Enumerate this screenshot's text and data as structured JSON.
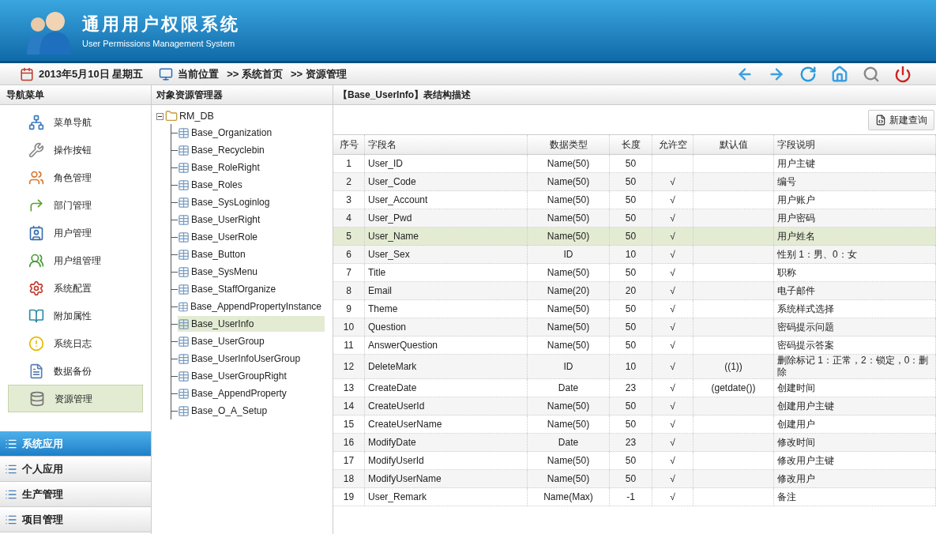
{
  "header": {
    "title": "通用用户权限系统",
    "subtitle": "User Permissions Management System"
  },
  "toolbar": {
    "date": "2013年5月10日 星期五",
    "location_label": "当前位置",
    "breadcrumb": [
      ">> 系统首页",
      ">> 资源管理"
    ],
    "actions": [
      {
        "kind": "back"
      },
      {
        "kind": "forward"
      },
      {
        "kind": "refresh"
      },
      {
        "kind": "home"
      },
      {
        "kind": "search"
      },
      {
        "kind": "power"
      }
    ]
  },
  "nav": {
    "title": "导航菜单",
    "items": [
      {
        "label": "菜单导航",
        "selected": false
      },
      {
        "label": "操作按钮",
        "selected": false
      },
      {
        "label": "角色管理",
        "selected": false
      },
      {
        "label": "部门管理",
        "selected": false
      },
      {
        "label": "用户管理",
        "selected": false
      },
      {
        "label": "用户组管理",
        "selected": false
      },
      {
        "label": "系统配置",
        "selected": false
      },
      {
        "label": "附加属性",
        "selected": false
      },
      {
        "label": "系统日志",
        "selected": false
      },
      {
        "label": "数据备份",
        "selected": false
      },
      {
        "label": "资源管理",
        "selected": true
      }
    ],
    "sections": [
      {
        "label": "系统应用",
        "selected": true
      },
      {
        "label": "个人应用",
        "selected": false
      },
      {
        "label": "生产管理",
        "selected": false
      },
      {
        "label": "项目管理",
        "selected": false
      }
    ]
  },
  "tree": {
    "title": "对象资源管理器",
    "root": {
      "label": "RM_DB",
      "expanded": true,
      "children": [
        {
          "label": "Base_Organization",
          "selected": false
        },
        {
          "label": "Base_Recyclebin",
          "selected": false
        },
        {
          "label": "Base_RoleRight",
          "selected": false
        },
        {
          "label": "Base_Roles",
          "selected": false
        },
        {
          "label": "Base_SysLoginlog",
          "selected": false
        },
        {
          "label": "Base_UserRight",
          "selected": false
        },
        {
          "label": "Base_UserRole",
          "selected": false
        },
        {
          "label": "Base_Button",
          "selected": false
        },
        {
          "label": "Base_SysMenu",
          "selected": false
        },
        {
          "label": "Base_StaffOrganize",
          "selected": false
        },
        {
          "label": "Base_AppendPropertyInstance",
          "selected": false
        },
        {
          "label": "Base_UserInfo",
          "selected": true
        },
        {
          "label": "Base_UserGroup",
          "selected": false
        },
        {
          "label": "Base_UserInfoUserGroup",
          "selected": false
        },
        {
          "label": "Base_UserGroupRight",
          "selected": false
        },
        {
          "label": "Base_AppendProperty",
          "selected": false
        },
        {
          "label": "Base_O_A_Setup",
          "selected": false
        }
      ]
    }
  },
  "detail": {
    "title": "【Base_UserInfo】表结构描述",
    "new_query_button": "新建查询",
    "table": {
      "columns": [
        "序号",
        "字段名",
        "数据类型",
        "长度",
        "允许空",
        "默认值",
        "字段说明"
      ],
      "rows": [
        {
          "no": "1",
          "name": "User_ID",
          "type": "Name(50)",
          "length": "50",
          "desc": "用户主键",
          "selected": false
        },
        {
          "no": "2",
          "name": "User_Code",
          "type": "Name(50)",
          "length": "50",
          "nullable": "√",
          "desc": "编号",
          "selected": false
        },
        {
          "no": "3",
          "name": "User_Account",
          "type": "Name(50)",
          "length": "50",
          "nullable": "√",
          "desc": "用户账户",
          "selected": false
        },
        {
          "no": "4",
          "name": "User_Pwd",
          "type": "Name(50)",
          "length": "50",
          "nullable": "√",
          "desc": "用户密码",
          "selected": false
        },
        {
          "no": "5",
          "name": "User_Name",
          "type": "Name(50)",
          "length": "50",
          "nullable": "√",
          "desc": "用户姓名",
          "selected": true
        },
        {
          "no": "6",
          "name": "User_Sex",
          "type": "ID",
          "length": "10",
          "nullable": "√",
          "desc": "性别 1：男、0：女",
          "selected": false
        },
        {
          "no": "7",
          "name": "Title",
          "type": "Name(50)",
          "length": "50",
          "nullable": "√",
          "desc": "职称",
          "selected": false
        },
        {
          "no": "8",
          "name": "Email",
          "type": "Name(20)",
          "length": "20",
          "nullable": "√",
          "desc": "电子邮件",
          "selected": false
        },
        {
          "no": "9",
          "name": "Theme",
          "type": "Name(50)",
          "length": "50",
          "nullable": "√",
          "desc": "系统样式选择",
          "selected": false
        },
        {
          "no": "10",
          "name": "Question",
          "type": "Name(50)",
          "length": "50",
          "nullable": "√",
          "desc": "密码提示问题",
          "selected": false
        },
        {
          "no": "11",
          "name": "AnswerQuestion",
          "type": "Name(50)",
          "length": "50",
          "nullable": "√",
          "desc": "密码提示答案",
          "selected": false
        },
        {
          "no": "12",
          "name": "DeleteMark",
          "type": "ID",
          "length": "10",
          "nullable": "√",
          "default": "((1))",
          "desc": "删除标记 1：正常，2：锁定，0：删除",
          "selected": false
        },
        {
          "no": "13",
          "name": "CreateDate",
          "type": "Date",
          "length": "23",
          "nullable": "√",
          "default": "(getdate())",
          "desc": "创建时间",
          "selected": false
        },
        {
          "no": "14",
          "name": "CreateUserId",
          "type": "Name(50)",
          "length": "50",
          "nullable": "√",
          "desc": "创建用户主键",
          "selected": false
        },
        {
          "no": "15",
          "name": "CreateUserName",
          "type": "Name(50)",
          "length": "50",
          "nullable": "√",
          "desc": "创建用户",
          "selected": false
        },
        {
          "no": "16",
          "name": "ModifyDate",
          "type": "Date",
          "length": "23",
          "nullable": "√",
          "desc": "修改时间",
          "selected": false
        },
        {
          "no": "17",
          "name": "ModifyUserId",
          "type": "Name(50)",
          "length": "50",
          "nullable": "√",
          "desc": "修改用户主键",
          "selected": false
        },
        {
          "no": "18",
          "name": "ModifyUserName",
          "type": "Name(50)",
          "length": "50",
          "nullable": "√",
          "desc": "修改用户",
          "selected": false
        },
        {
          "no": "19",
          "name": "User_Remark",
          "type": "Name(Max)",
          "length": "-1",
          "nullable": "√",
          "desc": "备注",
          "selected": false
        }
      ]
    }
  }
}
